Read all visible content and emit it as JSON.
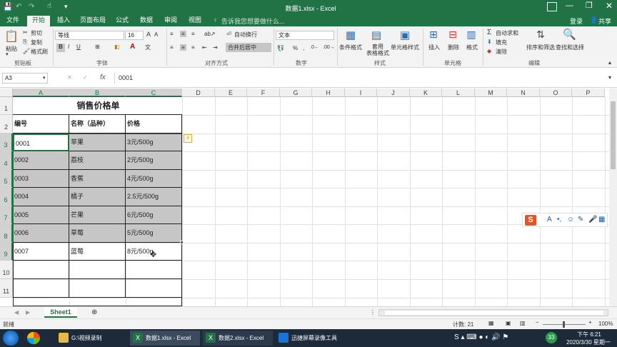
{
  "window": {
    "title": "数据1.xlsx - Excel",
    "search_placeholder": "告诉我您想要做什么...",
    "login": "登录",
    "share": "共享"
  },
  "tabs": [
    "文件",
    "开始",
    "插入",
    "页面布局",
    "公式",
    "数据",
    "审阅",
    "视图"
  ],
  "ribbon": {
    "clipboard": {
      "paste": "粘贴",
      "cut": "剪切",
      "copy": "复制",
      "format_painter": "格式刷",
      "group": "剪贴板"
    },
    "font": {
      "name": "等线",
      "size": "16",
      "bold": "B",
      "italic": "I",
      "underline": "U",
      "group": "字体"
    },
    "alignment": {
      "wrap": "自动换行",
      "merge": "合并后居中",
      "group": "对齐方式"
    },
    "number": {
      "format": "文本",
      "group": "数字"
    },
    "styles": {
      "conditional": "条件格式",
      "table_format": "套用\n表格格式",
      "cell_styles": "单元格样式",
      "group": "样式"
    },
    "cells": {
      "insert": "插入",
      "delete": "删除",
      "format": "格式",
      "group": "单元格"
    },
    "editing": {
      "autosum": "自动求和",
      "fill": "填充",
      "clear": "清除",
      "sort": "排序和筛选",
      "find": "查找和选择",
      "group": "编辑"
    }
  },
  "formula_bar": {
    "name_box": "A3",
    "fx": "fx",
    "value": "0001"
  },
  "columns": [
    "A",
    "B",
    "C",
    "D",
    "E",
    "F",
    "G",
    "H",
    "I",
    "J",
    "K",
    "L",
    "M",
    "N",
    "O",
    "P"
  ],
  "rows": [
    "1",
    "2",
    "3",
    "4",
    "5",
    "6",
    "7",
    "8",
    "9",
    "10",
    "11"
  ],
  "table": {
    "title": "销售价格单",
    "headers": [
      "编号",
      "名称（品种）",
      "价格"
    ],
    "rows": [
      [
        "0001",
        "苹果",
        "3元/500g"
      ],
      [
        "0002",
        "荔枝",
        "2元/500g"
      ],
      [
        "0003",
        "香蕉",
        "4元/500g"
      ],
      [
        "0004",
        "橘子",
        "2.5元/500g"
      ],
      [
        "0005",
        "芒果",
        "6元/500g"
      ],
      [
        "0006",
        "草莓",
        "5元/500g"
      ],
      [
        "0007",
        "蓝莓",
        "8元/500g"
      ]
    ]
  },
  "sheet_tab": "Sheet1",
  "status": {
    "ready": "就绪",
    "count": "计数: 21",
    "zoom": "100%"
  },
  "taskbar": {
    "items": [
      "G:\\视频录制",
      "数据1.xlsx - Excel",
      "数据2.xlsx - Excel",
      "迅捷屏幕录像工具"
    ],
    "time": "下午 6:21",
    "date": "2020/3/30 星期一"
  },
  "colors": {
    "excel_green": "#217346",
    "selection": "#c6c6c6",
    "taskbar": "#1c2a3a"
  }
}
